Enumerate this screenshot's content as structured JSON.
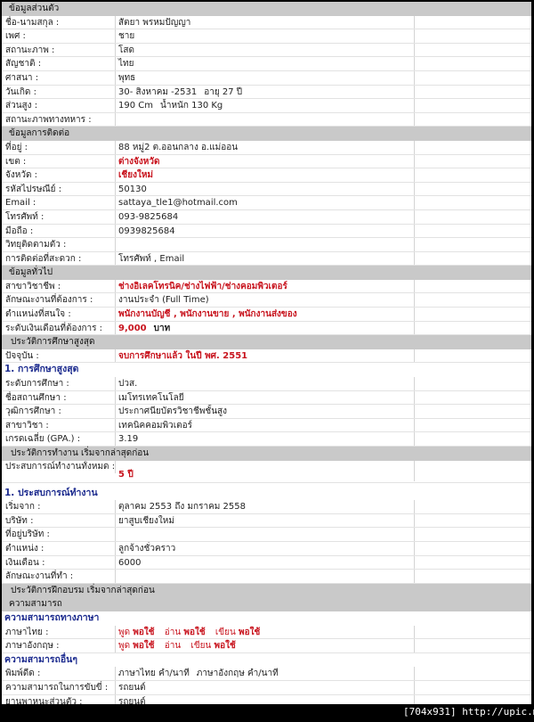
{
  "personal": {
    "header": "ข้อมูลส่วนตัว",
    "rows": [
      {
        "label": "ชื่อ-นามสกุล :",
        "value": "สัตยา พรหมปัญญา"
      },
      {
        "label": "เพศ :",
        "value": "ชาย"
      },
      {
        "label": "สถานะภาพ :",
        "value": "โสด"
      },
      {
        "label": "สัญชาติ :",
        "value": "ไทย"
      },
      {
        "label": "ศาสนา :",
        "value": "พุทธ"
      },
      {
        "label": "วันเกิด :",
        "value": "30- สิงหาคม -2531",
        "extra": "อายุ 27 ปี"
      },
      {
        "label": "ส่วนสูง :",
        "value": "190 Cm",
        "extra": "น้ำหนัก 130 Kg"
      },
      {
        "label": "สถานะภาพทางทหาร :",
        "value": ""
      }
    ]
  },
  "contact": {
    "header": "ข้อมูลการติดต่อ",
    "rows": [
      {
        "label": "ที่อยู่ :",
        "value": "88 หมู่2 ต.ออนกลาง อ.แม่ออน"
      },
      {
        "label": "เขต :",
        "value": "ต่างจังหวัด"
      },
      {
        "label": "จังหวัด :",
        "value": "เชียงใหม่"
      },
      {
        "label": "รหัสไปรษณีย์ :",
        "value": "50130"
      },
      {
        "label": "Email :",
        "value": "sattaya_tle1@hotmail.com"
      },
      {
        "label": "โทรศัพท์ :",
        "value": "093-9825684"
      },
      {
        "label": "มือถือ :",
        "value": "0939825684"
      },
      {
        "label": "วิทยุติดตามตัว :",
        "value": ""
      },
      {
        "label": "การติดต่อที่สะดวก :",
        "value": "โทรศัพท์ , Email"
      }
    ]
  },
  "general": {
    "header": "ข้อมูลทั่วไป",
    "rows": [
      {
        "label": "สาขาวิชาชีพ :",
        "value": "ช่างอิเลคโทรนิค/ช่างไฟฟ้า/ช่างคอมพิวเตอร์"
      },
      {
        "label": "ลักษณะงานที่ต้องการ :",
        "value": "งานประจำ (Full Time)"
      },
      {
        "label": "ตำแหน่งที่สนใจ :",
        "value": "พนักงานบัญชี , พนักงานขาย , พนักงานส่งของ"
      },
      {
        "label": "ระดับเงินเดือนที่ต้องการ :",
        "value": "9,000",
        "extra": "บาท"
      }
    ]
  },
  "education": {
    "header": "ประวัติการศึกษาสูงสุด",
    "current_label": "ปัจจุบัน :",
    "current_value": "จบการศึกษาแล้ว ในปี พศ. 2551",
    "section_title": "1. การศึกษาสูงสุด",
    "rows": [
      {
        "label": "ระดับการศึกษา :",
        "value": "ปวส."
      },
      {
        "label": "ชื่อสถานศึกษา :",
        "value": "เมโทรเทคโนโลยี"
      },
      {
        "label": "วุฒิการศึกษา :",
        "value": "ประกาศนียบัตรวิชาชีพชั้นสูง"
      },
      {
        "label": "สาขาวิชา :",
        "value": "เทคนิคคอมพิวเตอร์"
      },
      {
        "label": "เกรดเฉลี่ย (GPA.) :",
        "value": "3.19"
      }
    ]
  },
  "work": {
    "header": "ประวัติการทำงาน เริ่มจากล่าสุดก่อน",
    "total_label": "ประสบการณ์ทำงานทั้งหมด :",
    "total_value": "5 ปี",
    "section_title": "1. ประสบการณ์ทำงาน",
    "rows": [
      {
        "label": "เริ่มจาก :",
        "value": "ตุลาคม 2553 ถึง มกราคม 2558"
      },
      {
        "label": "บริษัท :",
        "value": "ยาสูบเชียงใหม่"
      },
      {
        "label": "ที่อยู่บริษัท :",
        "value": ""
      },
      {
        "label": "ตำแหน่ง :",
        "value": "ลูกจ้างชั่วคราว"
      },
      {
        "label": "เงินเดือน :",
        "value": "6000"
      },
      {
        "label": "ลักษณะงานที่ทำ :",
        "value": ""
      }
    ]
  },
  "training": {
    "header": "ประวัติการฝึกอบรม เริ่มจากล่าสุดก่อน"
  },
  "ability": {
    "header": "ความสามารถ",
    "language_title": "ความสามารถทางภาษา",
    "languages": [
      {
        "label": "ภาษาไทย :",
        "speak": "พูด",
        "speak_level": "พอใช้",
        "read": "อ่าน",
        "read_level": "พอใช้",
        "write": "เขียน",
        "write_level": "พอใช้"
      },
      {
        "label": "ภาษาอังกฤษ :",
        "speak": "พูด",
        "speak_level": "พอใช้",
        "read": "อ่าน",
        "read_level": "",
        "write": "เขียน",
        "write_level": "พอใช้"
      }
    ],
    "other_title": "ความสามารถอื่นๆ",
    "other_rows": [
      {
        "label": "พิมพ์ดีด :",
        "value": "ภาษาไทย คำ/นาที",
        "extra": "ภาษาอังกฤษ คำ/นาที"
      },
      {
        "label": "ความสามารถในการขับขี่ :",
        "value": "รถยนต์"
      },
      {
        "label": "ยานพาหนะส่วนตัว :",
        "value": "รถยนต์"
      }
    ]
  },
  "watermark": "[704x931] http://upic.me/",
  "colors": {
    "header_bg": "#c9c9c9",
    "highlight": "#c8141e",
    "section_title": "#1d2c8f"
  }
}
